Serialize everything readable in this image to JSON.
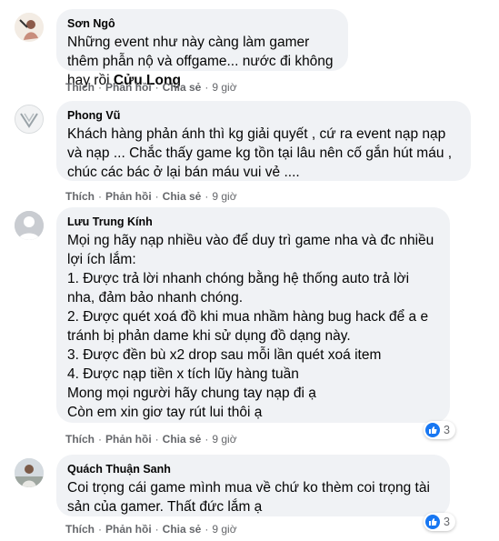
{
  "comments": [
    {
      "author": "Sơn Ngô",
      "text_main": "Những event như này càng làm gamer thêm phẫn nộ và offgame... nước đi không hay rồi ",
      "text_tag": "Cửu Long",
      "actions": {
        "like": "Thích",
        "reply": "Phản hồi",
        "share": "Chia sẻ",
        "time": "9 giờ"
      }
    },
    {
      "author": "Phong Vũ",
      "text": "Khách hàng phản ánh thì kg giải quyết , cứ ra event nạp nạp và nạp ... Chắc thấy game kg tồn tại lâu nên cố gắn hút máu , chúc các bác ở lại bán máu vui vẻ ....",
      "actions": {
        "like": "Thích",
        "reply": "Phản hồi",
        "share": "Chia sẻ",
        "time": "9 giờ"
      }
    },
    {
      "author": "Lưu Trung Kính",
      "text": "Mọi ng hãy nạp nhiều vào để duy trì game nha và đc nhiều lợi ích lắm:\n1. Được trả lời nhanh chóng bằng hệ thống auto trả lời nha, đảm bảo nhanh chóng.\n2. Được quét xoá đồ khi mua nhầm hàng bug hack để a e tránh bị phản dame khi sử dụng đồ dạng này.\n3. Được đền bù x2 drop sau mỗi lần quét xoá item\n4. Được nạp tiền x tích lũy hàng tuần\nMong mọi người hãy chung tay nạp đi ạ\nCòn em xin giơ tay rút lui thôi ạ",
      "reaction_count": "3",
      "actions": {
        "like": "Thích",
        "reply": "Phản hồi",
        "share": "Chia sẻ",
        "time": "9 giờ"
      }
    },
    {
      "author": "Quách Thuận Sanh",
      "text": "Coi trọng cái game mình mua về chứ ko thèm coi trọng tài sản của gamer. Thất đức lắm ạ",
      "reaction_count": "3",
      "actions": {
        "like": "Thích",
        "reply": "Phản hồi",
        "share": "Chia sẻ",
        "time": "9 giờ"
      }
    }
  ],
  "colors": {
    "bubble": "#f0f2f5",
    "meta": "#65676b",
    "like": "#1877f2"
  }
}
